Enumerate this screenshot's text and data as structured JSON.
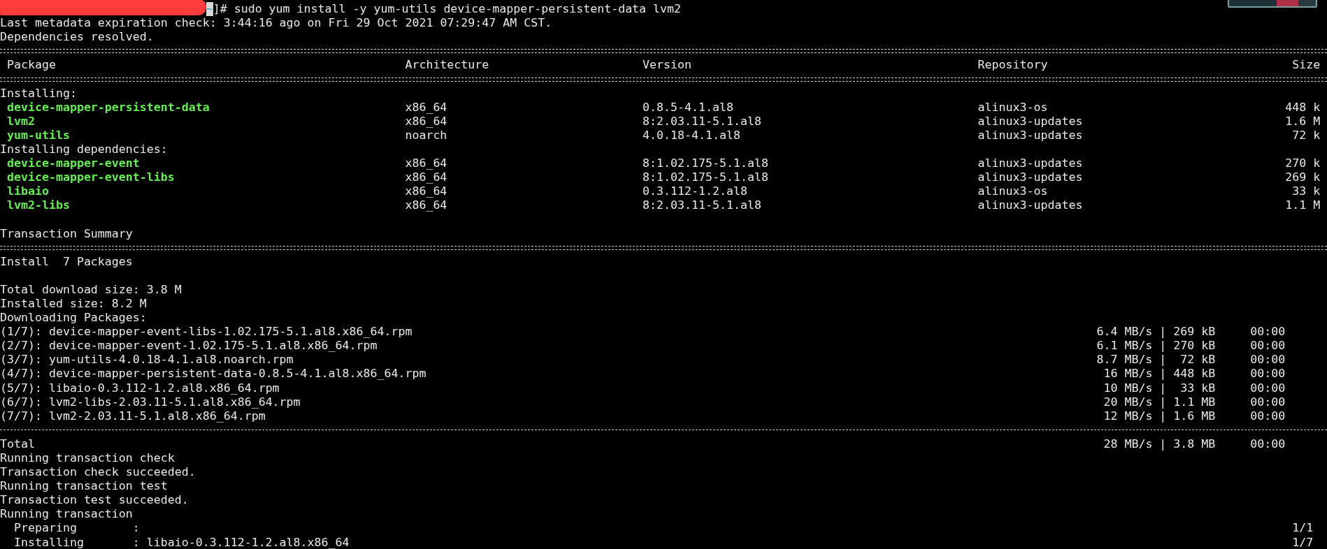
{
  "prompt": {
    "cwd": "~",
    "suffix": "]#",
    "command": "sudo yum install -y yum-utils device-mapper-persistent-data lvm2"
  },
  "messages": [
    "Last metadata expiration check: 3:44:16 ago on Fri 29 Oct 2021 07:29:47 AM CST.",
    "Dependencies resolved."
  ],
  "table": {
    "columns": [
      "Package",
      "Architecture",
      "Version",
      "Repository",
      "Size"
    ],
    "groups": [
      {
        "heading": "Installing:",
        "packages": [
          {
            "name": "device-mapper-persistent-data",
            "arch": "x86_64",
            "version": "0.8.5-4.1.al8",
            "repo": "alinux3-os",
            "size": "448 k"
          },
          {
            "name": "lvm2",
            "arch": "x86_64",
            "version": "8:2.03.11-5.1.al8",
            "repo": "alinux3-updates",
            "size": "1.6 M"
          },
          {
            "name": "yum-utils",
            "arch": "noarch",
            "version": "4.0.18-4.1.al8",
            "repo": "alinux3-updates",
            "size": "72 k"
          }
        ]
      },
      {
        "heading": "Installing dependencies:",
        "packages": [
          {
            "name": "device-mapper-event",
            "arch": "x86_64",
            "version": "8:1.02.175-5.1.al8",
            "repo": "alinux3-updates",
            "size": "270 k"
          },
          {
            "name": "device-mapper-event-libs",
            "arch": "x86_64",
            "version": "8:1.02.175-5.1.al8",
            "repo": "alinux3-updates",
            "size": "269 k"
          },
          {
            "name": "libaio",
            "arch": "x86_64",
            "version": "0.3.112-1.2.al8",
            "repo": "alinux3-os",
            "size": "33 k"
          },
          {
            "name": "lvm2-libs",
            "arch": "x86_64",
            "version": "8:2.03.11-5.1.al8",
            "repo": "alinux3-updates",
            "size": "1.1 M"
          }
        ]
      }
    ]
  },
  "summary": {
    "title": "Transaction Summary",
    "install": "Install  7 Packages",
    "lines": [
      "Total download size: 3.8 M",
      "Installed size: 8.2 M",
      "Downloading Packages:"
    ]
  },
  "downloads": [
    {
      "name": "(1/7): device-mapper-event-libs-1.02.175-5.1.al8.x86_64.rpm",
      "rate": "6.4 MB/s",
      "divider": "|",
      "size": "269 kB",
      "time": "00:00"
    },
    {
      "name": "(2/7): device-mapper-event-1.02.175-5.1.al8.x86_64.rpm",
      "rate": "6.1 MB/s",
      "divider": "|",
      "size": "270 kB",
      "time": "00:00"
    },
    {
      "name": "(3/7): yum-utils-4.0.18-4.1.al8.noarch.rpm",
      "rate": "8.7 MB/s",
      "divider": "|",
      "size": "72 kB",
      "time": "00:00"
    },
    {
      "name": "(4/7): device-mapper-persistent-data-0.8.5-4.1.al8.x86_64.rpm",
      "rate": "16 MB/s",
      "divider": "|",
      "size": "448 kB",
      "time": "00:00"
    },
    {
      "name": "(5/7): libaio-0.3.112-1.2.al8.x86_64.rpm",
      "rate": "10 MB/s",
      "divider": "|",
      "size": "33 kB",
      "time": "00:00"
    },
    {
      "name": "(6/7): lvm2-libs-2.03.11-5.1.al8.x86_64.rpm",
      "rate": "20 MB/s",
      "divider": "|",
      "size": "1.1 MB",
      "time": "00:00"
    },
    {
      "name": "(7/7): lvm2-2.03.11-5.1.al8.x86_64.rpm",
      "rate": "12 MB/s",
      "divider": "|",
      "size": "1.6 MB",
      "time": "00:00"
    }
  ],
  "total": {
    "name": "Total",
    "rate": "28 MB/s",
    "divider": "|",
    "size": "3.8 MB",
    "time": "00:00"
  },
  "transaction": [
    "Running transaction check",
    "Transaction check succeeded.",
    "Running transaction test",
    "Transaction test succeeded.",
    "Running transaction"
  ],
  "steps": [
    {
      "label": "Preparing",
      "separator": ":",
      "counter": "1/1"
    },
    {
      "label": "Installing",
      "separator": ":",
      "value": "libaio-0.3.112-1.2.al8.x86_64",
      "counter": "1/7"
    }
  ]
}
